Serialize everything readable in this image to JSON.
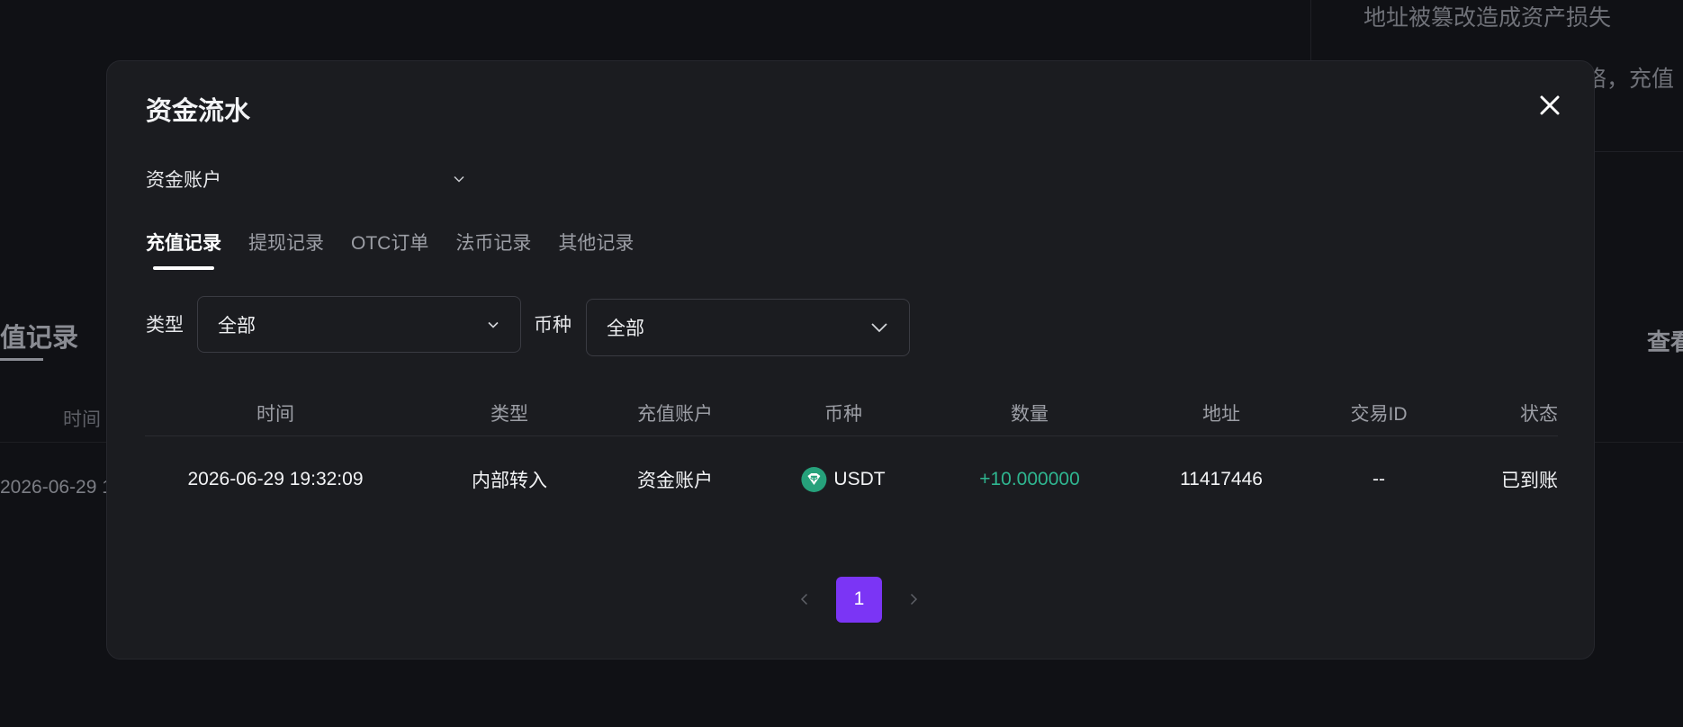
{
  "background": {
    "warning_line1": "地址被篡改造成资产损失",
    "warning_line2": "络，充值",
    "tab_label": "值记录",
    "view_link": "查看",
    "column_time": "时间",
    "row_time": "2026-06-29 1"
  },
  "modal": {
    "title": "资金流水",
    "account_select": {
      "value": "资金账户"
    },
    "tabs": [
      {
        "label": "充值记录",
        "active": true
      },
      {
        "label": "提现记录",
        "active": false
      },
      {
        "label": "OTC订单",
        "active": false
      },
      {
        "label": "法币记录",
        "active": false
      },
      {
        "label": "其他记录",
        "active": false
      }
    ],
    "filters": {
      "type_label": "类型",
      "type_value": "全部",
      "currency_label": "币种",
      "currency_value": "全部"
    },
    "table": {
      "headers": [
        "时间",
        "类型",
        "充值账户",
        "币种",
        "数量",
        "地址",
        "交易ID",
        "状态"
      ],
      "rows": [
        {
          "time": "2026-06-29 19:32:09",
          "type": "内部转入",
          "account": "资金账户",
          "currency": "USDT",
          "amount": "+10.000000",
          "address": "11417446",
          "txid": "--",
          "status": "已到账"
        }
      ]
    },
    "pagination": {
      "current_page": "1"
    },
    "colors": {
      "accent": "#7b35f5",
      "positive": "#2fb690",
      "usdt": "#26a17b"
    },
    "icons": [
      "close-icon",
      "chevron-down-icon",
      "usdt-icon",
      "chevron-left-icon",
      "chevron-right-icon"
    ]
  }
}
